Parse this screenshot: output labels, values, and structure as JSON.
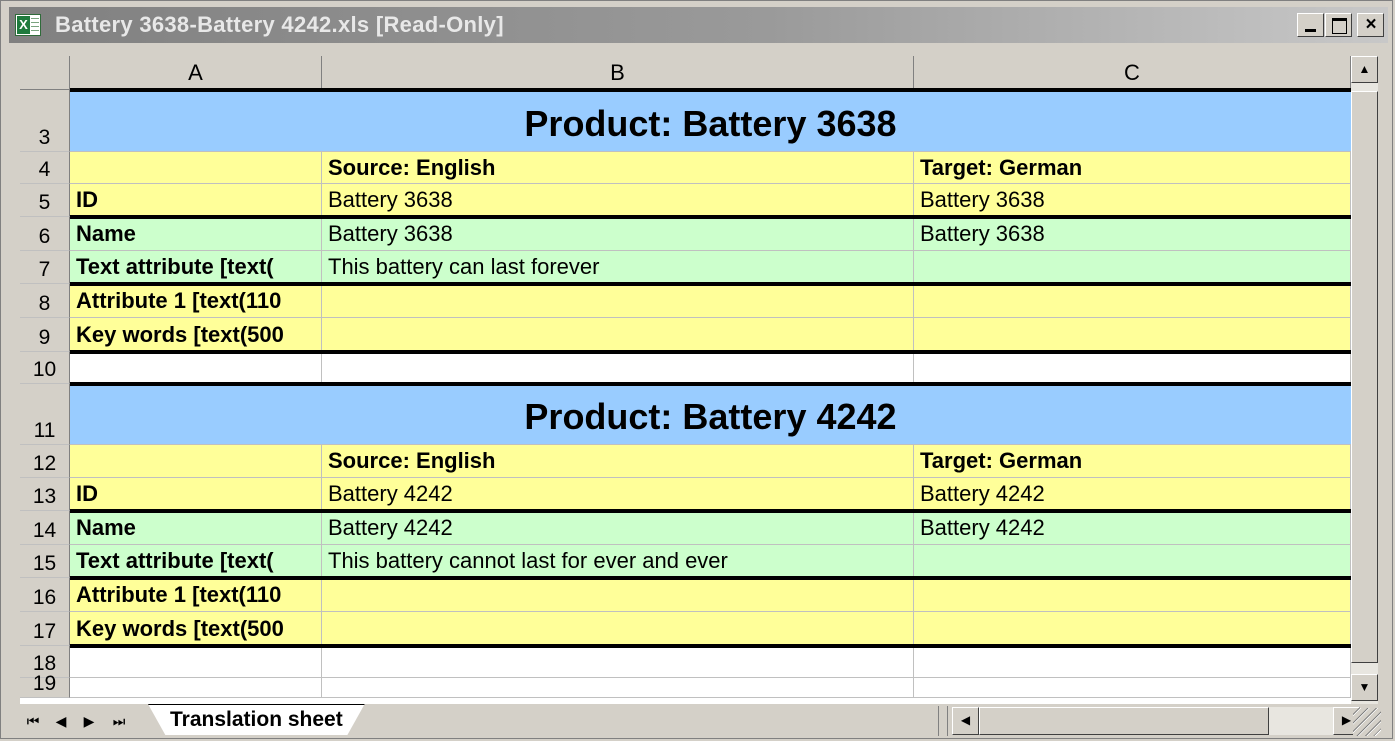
{
  "window": {
    "title": "Battery 3638-Battery 4242.xls  [Read-Only]",
    "buttons": {
      "minimize": "minimize",
      "maximize": "maximize",
      "close": "×"
    }
  },
  "columns": [
    "A",
    "B",
    "C"
  ],
  "rows": [
    {
      "n": "3",
      "kind": "title",
      "title": "Product: Battery 3638",
      "color": "#99ccff"
    },
    {
      "n": "4",
      "kind": "header",
      "a": "",
      "b": "Source: English",
      "c": "Target: German",
      "color": "#ffff99"
    },
    {
      "n": "5",
      "kind": "data",
      "a": "ID",
      "b": "Battery 3638",
      "c": "Battery 3638",
      "color": "#ffff99"
    },
    {
      "n": "6",
      "kind": "data",
      "a": "Name",
      "b": "Battery 3638",
      "c": "Battery 3638",
      "color": "#ccffcc"
    },
    {
      "n": "7",
      "kind": "data",
      "a": "Text attribute [text(",
      "b": "This battery can last forever",
      "c": "",
      "color": "#ccffcc"
    },
    {
      "n": "8",
      "kind": "data",
      "a": "Attribute 1 [text(110",
      "b": "",
      "c": "",
      "color": "#ffff99"
    },
    {
      "n": "9",
      "kind": "data",
      "a": "Key words [text(500",
      "b": "",
      "c": "",
      "color": "#ffff99"
    },
    {
      "n": "10",
      "kind": "blank",
      "color": "#ffffff"
    },
    {
      "n": "11",
      "kind": "title",
      "title": "Product: Battery 4242",
      "color": "#99ccff"
    },
    {
      "n": "12",
      "kind": "header",
      "a": "",
      "b": "Source: English",
      "c": "Target: German",
      "color": "#ffff99"
    },
    {
      "n": "13",
      "kind": "data",
      "a": "ID",
      "b": "Battery 4242",
      "c": "Battery 4242",
      "color": "#ffff99"
    },
    {
      "n": "14",
      "kind": "data",
      "a": "Name",
      "b": "Battery 4242",
      "c": "Battery 4242",
      "color": "#ccffcc"
    },
    {
      "n": "15",
      "kind": "data",
      "a": "Text attribute [text(",
      "b": "This battery cannot last for ever and ever",
      "c": "",
      "color": "#ccffcc"
    },
    {
      "n": "16",
      "kind": "data",
      "a": "Attribute 1 [text(110",
      "b": "",
      "c": "",
      "color": "#ffff99"
    },
    {
      "n": "17",
      "kind": "data",
      "a": "Key words [text(500",
      "b": "",
      "c": "",
      "color": "#ffff99"
    },
    {
      "n": "18",
      "kind": "blank",
      "color": "#ffffff"
    },
    {
      "n": "19",
      "kind": "blank",
      "color": "#ffffff"
    }
  ],
  "sheet_tabs": {
    "active": "Translation sheet"
  },
  "icons": {
    "app": "excel-document-icon",
    "first": "⏮",
    "prev": "◀",
    "next": "▶",
    "last": "⏭",
    "up": "▲",
    "down": "▼",
    "left": "◀",
    "right": "▶"
  }
}
